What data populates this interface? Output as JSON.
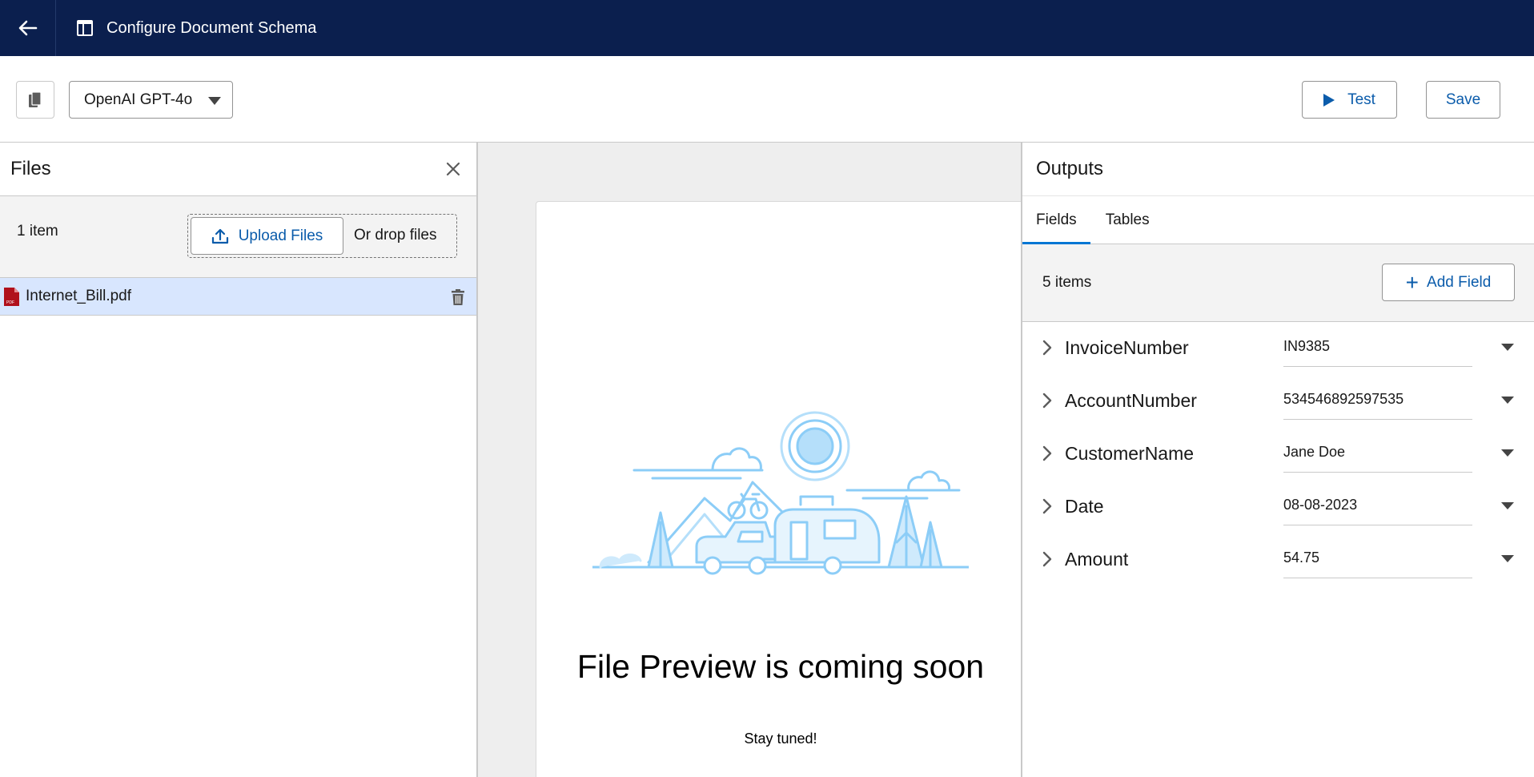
{
  "header": {
    "title": "Configure Document Schema",
    "back_icon": "arrow-left-icon",
    "title_icon": "layout-icon",
    "bg_color": "#0b1f4e"
  },
  "toolbar": {
    "copy_icon": "copy-icon",
    "model_selected": "OpenAI GPT-4o",
    "test_label": "Test",
    "save_label": "Save"
  },
  "files": {
    "title": "Files",
    "count_label": "1 item",
    "upload_label": "Upload Files",
    "drop_label": "Or drop files",
    "items": [
      {
        "name": "Internet_Bill.pdf",
        "icon": "pdf-icon"
      }
    ]
  },
  "preview": {
    "title": "File Preview is coming soon",
    "subtitle": "Stay tuned!"
  },
  "outputs": {
    "title": "Outputs",
    "tabs": [
      {
        "label": "Fields",
        "active": true
      },
      {
        "label": "Tables",
        "active": false
      }
    ],
    "count_label": "5 items",
    "add_field_label": "Add Field",
    "fields": [
      {
        "name": "InvoiceNumber",
        "value": "IN9385"
      },
      {
        "name": "AccountNumber",
        "value": "534546892597535"
      },
      {
        "name": "CustomerName",
        "value": "Jane Doe"
      },
      {
        "name": "Date",
        "value": "08-08-2023"
      },
      {
        "name": "Amount",
        "value": "54.75"
      }
    ]
  },
  "colors": {
    "accent": "#0176d3",
    "link": "#0b5cab",
    "selected_row": "#d8e6fe"
  }
}
